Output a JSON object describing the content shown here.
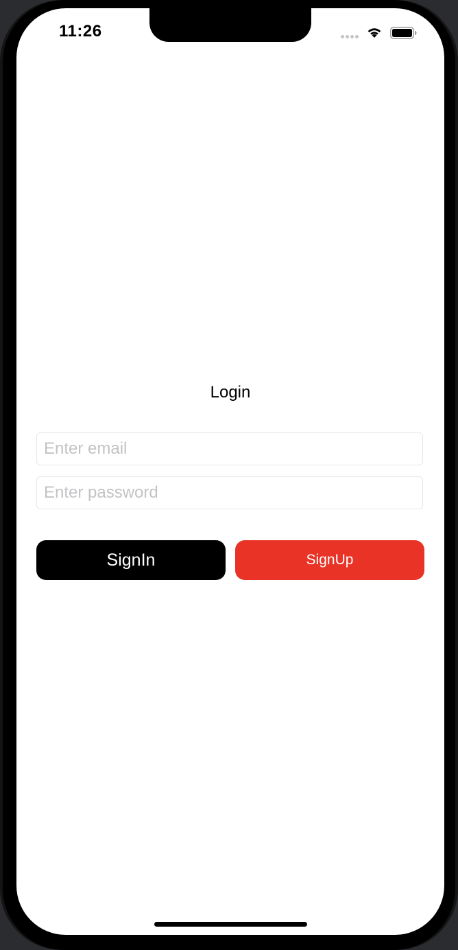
{
  "status_bar": {
    "time": "11:26",
    "signal_icon": "cellular-signal-icon",
    "wifi_icon": "wifi-icon",
    "battery_icon": "battery-icon"
  },
  "login": {
    "title": "Login",
    "email_placeholder": "Enter email",
    "email_value": "",
    "password_placeholder": "Enter password",
    "password_value": "",
    "signin_label": "SignIn",
    "signup_label": "SignUp"
  },
  "colors": {
    "signin_button": "#000000",
    "signup_button": "#e83326",
    "background": "#ffffff"
  }
}
